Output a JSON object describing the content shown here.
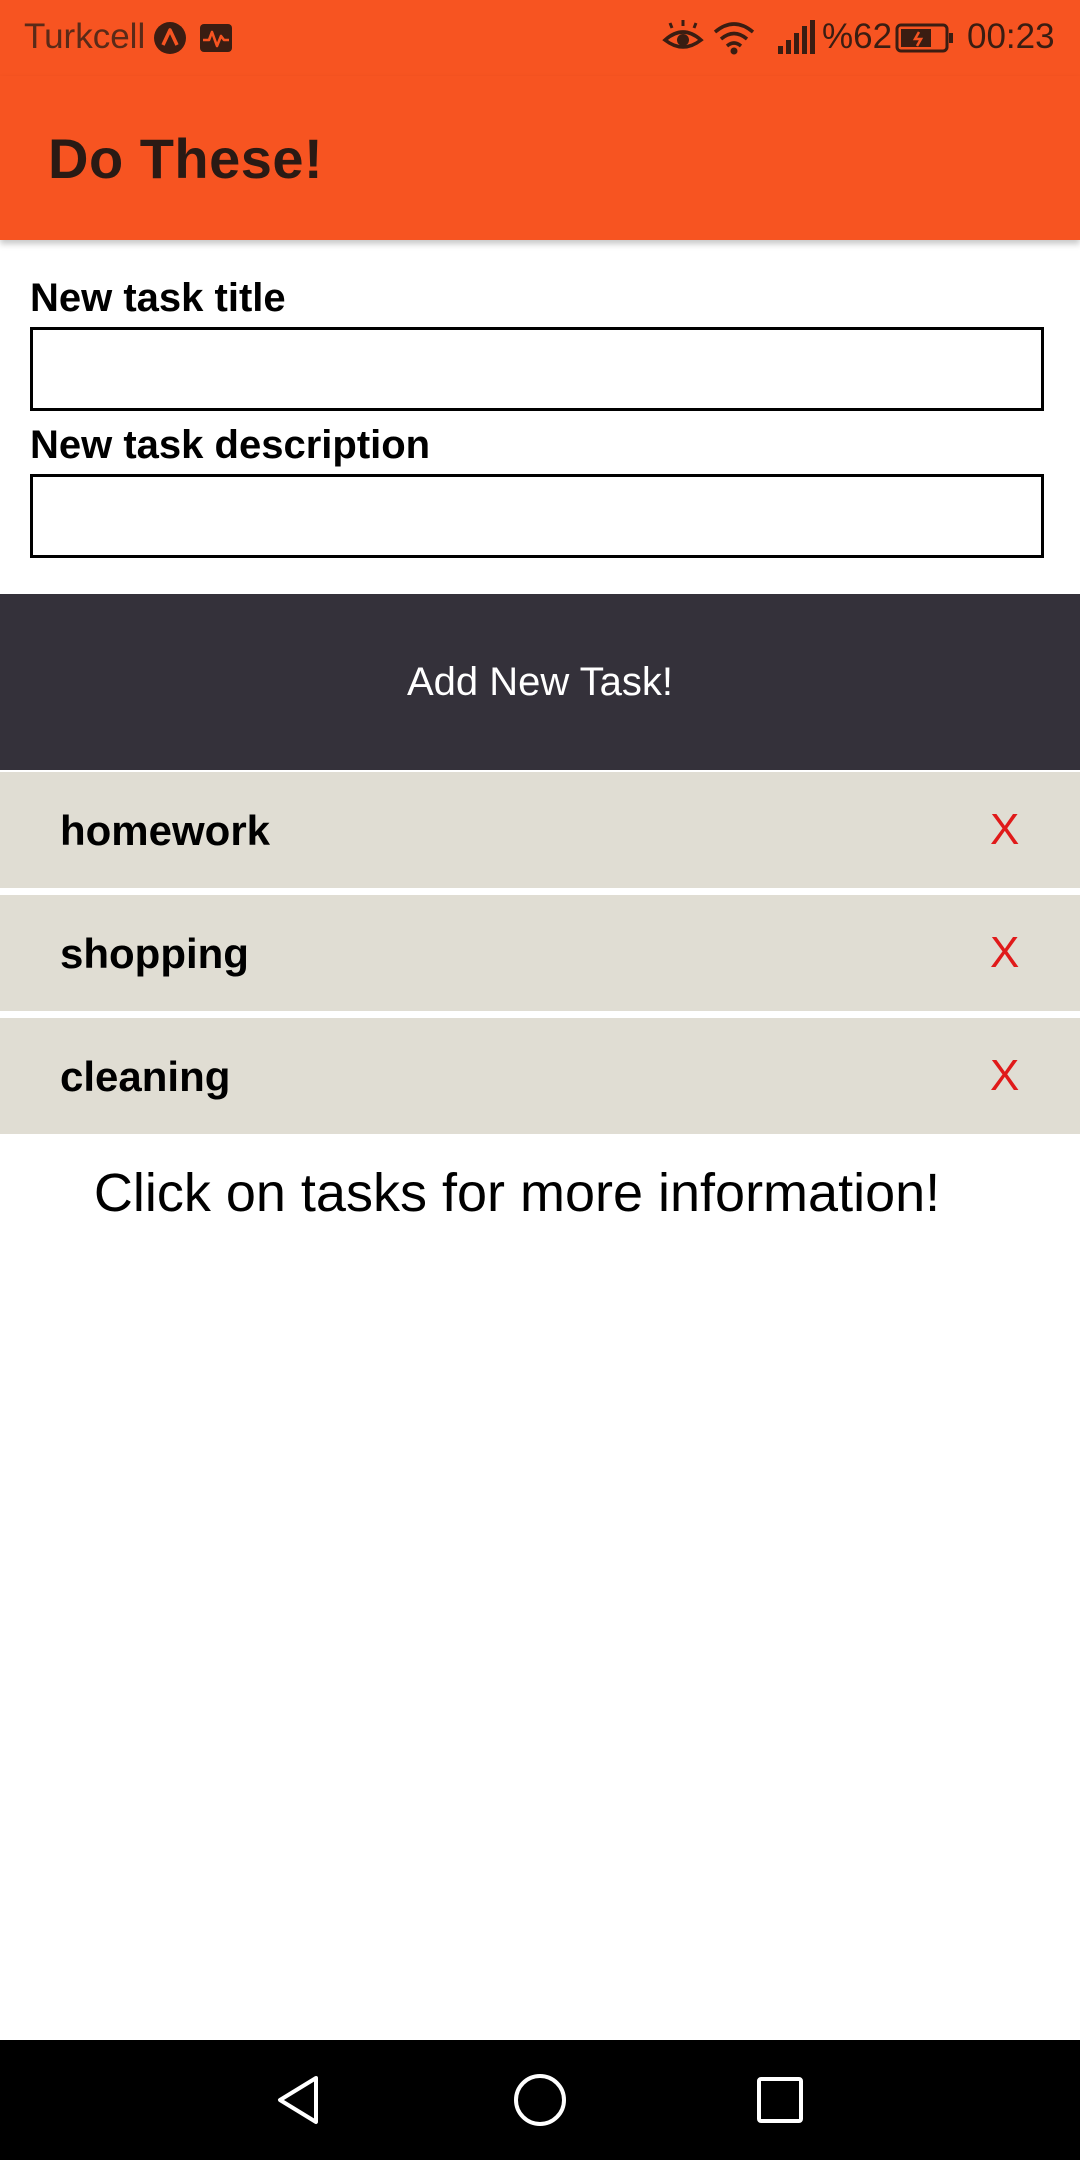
{
  "status_bar": {
    "carrier": "Turkcell",
    "battery": "%62",
    "time": "00:23",
    "icons": [
      "vpn-icon",
      "pulse-icon",
      "eye-comfort-icon",
      "wifi-icon",
      "signal-icon",
      "battery-icon"
    ]
  },
  "app_bar": {
    "title": "Do These!",
    "color": "#f75421"
  },
  "form": {
    "title_label": "New task title",
    "title_value": "",
    "description_label": "New task description",
    "description_value": ""
  },
  "add_button": {
    "label": "Add New Task!",
    "color": "#34313a"
  },
  "tasks": [
    {
      "title": "homework",
      "delete_label": "X"
    },
    {
      "title": "shopping",
      "delete_label": "X"
    },
    {
      "title": "cleaning",
      "delete_label": "X"
    }
  ],
  "hint": "Click on tasks for more information!",
  "nav_bar": {
    "icons": [
      "back-icon",
      "home-icon",
      "recents-icon"
    ]
  }
}
